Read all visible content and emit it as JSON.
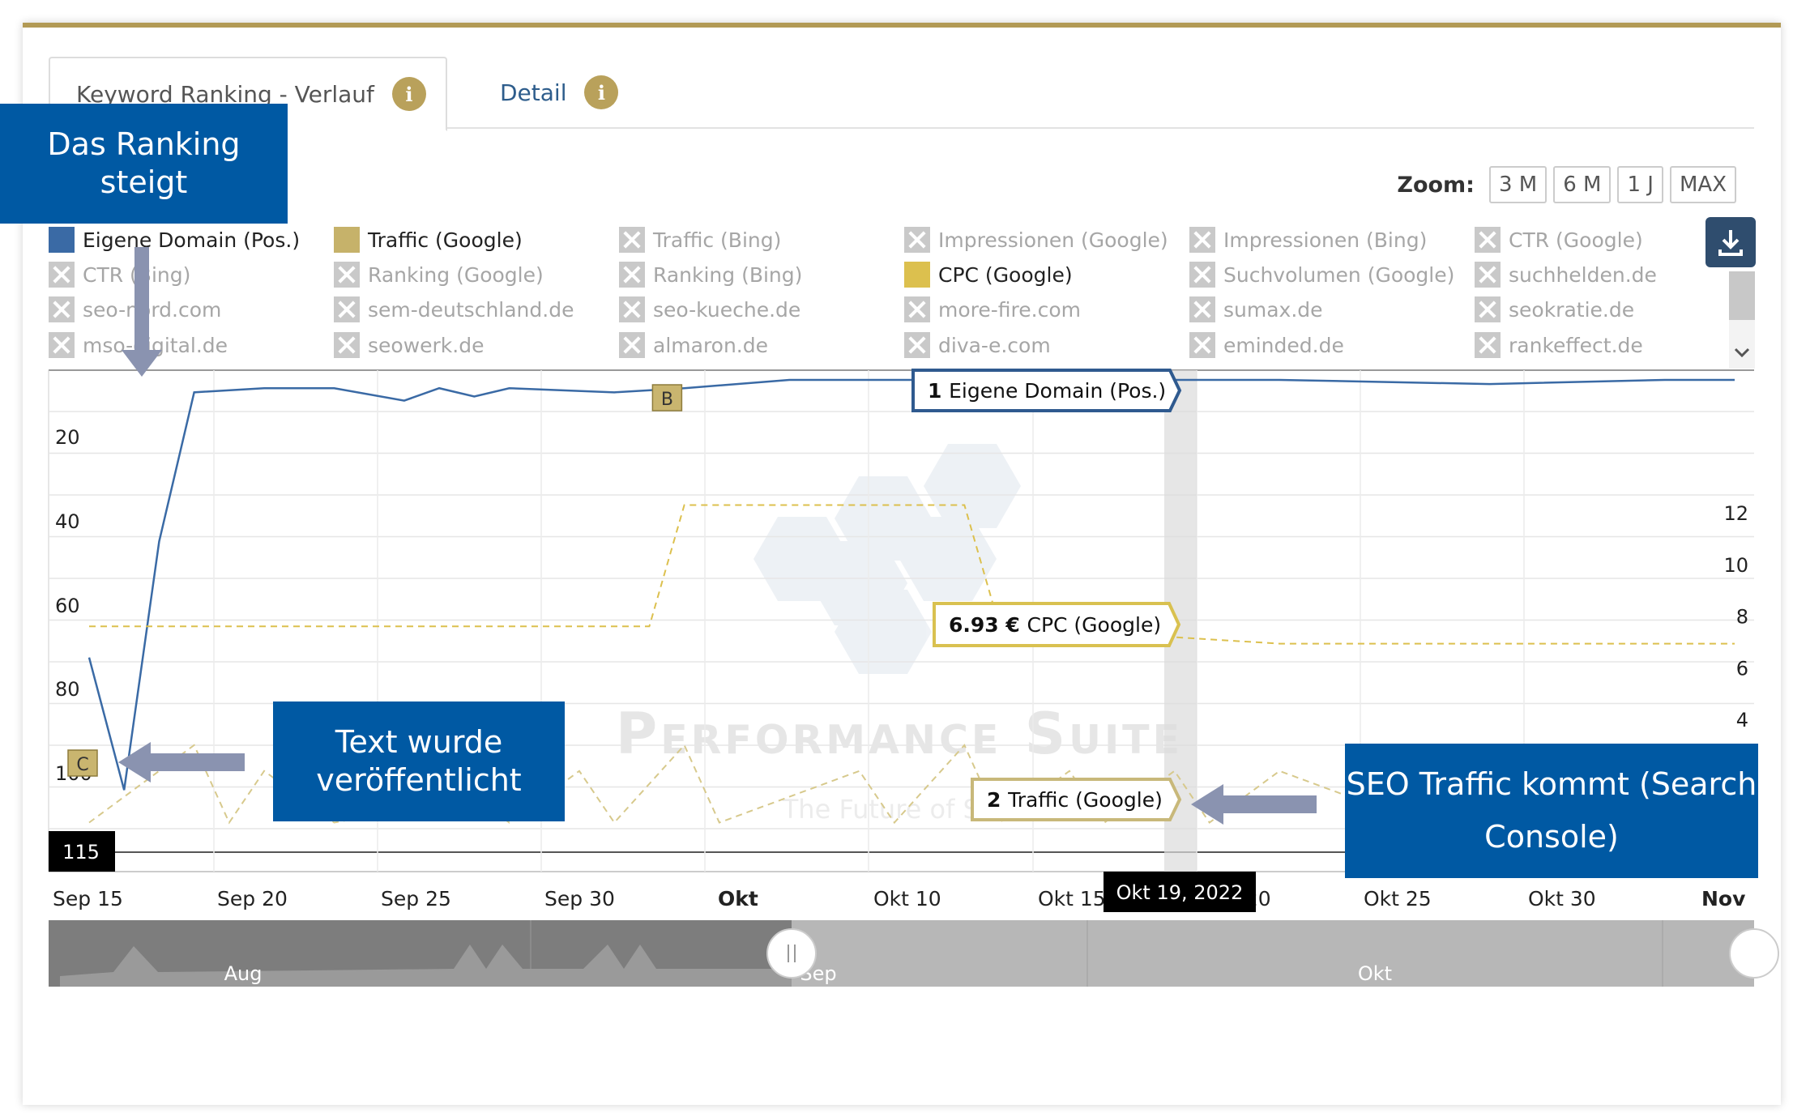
{
  "tabs": [
    {
      "label": "Keyword Ranking - Verlauf",
      "active": true
    },
    {
      "label": "Detail",
      "active": false
    }
  ],
  "zoom": {
    "label": "Zoom:",
    "options": [
      "3 M",
      "6 M",
      "1 J",
      "MAX"
    ]
  },
  "legend": [
    {
      "label": "Eigene Domain (Pos.)",
      "on": true,
      "color": "#3a6aa5"
    },
    {
      "label": "Traffic (Google)",
      "on": true,
      "color": "#c6b26a"
    },
    {
      "label": "Traffic (Bing)",
      "on": false
    },
    {
      "label": "Impressionen (Google)",
      "on": false
    },
    {
      "label": "Impressionen (Bing)",
      "on": false
    },
    {
      "label": "CTR (Google)",
      "on": false
    },
    {
      "label": "CTR (Bing)",
      "on": false
    },
    {
      "label": "Ranking (Google)",
      "on": false
    },
    {
      "label": "Ranking (Bing)",
      "on": false
    },
    {
      "label": "CPC (Google)",
      "on": true,
      "color": "#dcc04e"
    },
    {
      "label": "Suchvolumen (Google)",
      "on": false
    },
    {
      "label": "suchhelden.de",
      "on": false
    },
    {
      "label": "seo-nord.com",
      "on": false
    },
    {
      "label": "sem-deutschland.de",
      "on": false
    },
    {
      "label": "seo-kueche.de",
      "on": false
    },
    {
      "label": "more-fire.com",
      "on": false
    },
    {
      "label": "sumax.de",
      "on": false
    },
    {
      "label": "seokratie.de",
      "on": false
    },
    {
      "label": "mso-digital.de",
      "on": false
    },
    {
      "label": "seowerk.de",
      "on": false
    },
    {
      "label": "almaron.de",
      "on": false
    },
    {
      "label": "diva-e.com",
      "on": false
    },
    {
      "label": "eminded.de",
      "on": false
    },
    {
      "label": "rankeffect.de",
      "on": false
    }
  ],
  "callouts": {
    "ranking": "Das Ranking steigt",
    "text": "Text wurde veröffentlicht",
    "seo": "SEO Traffic kommt (Search Console)"
  },
  "watermark": {
    "title": "Performance Suite",
    "subtitle": "The Future of SEO"
  },
  "chart_data": {
    "type": "line",
    "x_labels": [
      "Sep 15",
      "Sep 20",
      "Sep 25",
      "Sep 30",
      "Okt",
      "Okt 10",
      "Okt 15",
      "Okt 20",
      "Okt 25",
      "Okt 30",
      "Nov"
    ],
    "left_axis": {
      "ticks": [
        20,
        40,
        60,
        80,
        100
      ],
      "min_label": "115",
      "reversed": true
    },
    "right_axis": {
      "ticks": [
        4,
        6,
        8,
        10,
        12
      ]
    },
    "series": [
      {
        "name": "Eigene Domain (Pos.)",
        "axis": "left",
        "color": "#3a6aa5",
        "points": [
          [
            "2022-09-15",
            68
          ],
          [
            "2022-09-16",
            100
          ],
          [
            "2022-09-17",
            40
          ],
          [
            "2022-09-18",
            4
          ],
          [
            "2022-09-20",
            3
          ],
          [
            "2022-09-22",
            3
          ],
          [
            "2022-09-24",
            6
          ],
          [
            "2022-09-25",
            3
          ],
          [
            "2022-09-26",
            5
          ],
          [
            "2022-09-27",
            3
          ],
          [
            "2022-09-30",
            4
          ],
          [
            "2022-10-02",
            3
          ],
          [
            "2022-10-05",
            1
          ],
          [
            "2022-10-10",
            1
          ],
          [
            "2022-10-15",
            1
          ],
          [
            "2022-10-19",
            1
          ],
          [
            "2022-10-25",
            2
          ],
          [
            "2022-10-30",
            1
          ],
          [
            "2022-11-01",
            1
          ]
        ]
      },
      {
        "name": "CPC (Google)",
        "axis": "right",
        "color": "#dcc04e",
        "dashed": true,
        "points": [
          [
            "2022-09-15",
            7.6
          ],
          [
            "2022-10-01",
            7.6
          ],
          [
            "2022-10-02",
            12.3
          ],
          [
            "2022-10-10",
            12.3
          ],
          [
            "2022-10-11",
            7.6
          ],
          [
            "2022-10-19",
            6.93
          ],
          [
            "2022-11-01",
            6.93
          ]
        ]
      },
      {
        "name": "Traffic (Google)",
        "axis": "right",
        "color": "#d7c98c",
        "dashed": true,
        "points": [
          [
            "2022-09-15",
            0
          ],
          [
            "2022-09-18",
            3
          ],
          [
            "2022-09-19",
            0
          ],
          [
            "2022-09-20",
            2
          ],
          [
            "2022-09-22",
            0
          ],
          [
            "2022-09-26",
            1
          ],
          [
            "2022-09-27",
            0
          ],
          [
            "2022-09-29",
            2
          ],
          [
            "2022-09-30",
            0
          ],
          [
            "2022-10-02",
            3
          ],
          [
            "2022-10-03",
            0
          ],
          [
            "2022-10-07",
            2
          ],
          [
            "2022-10-08",
            0
          ],
          [
            "2022-10-10",
            3
          ],
          [
            "2022-10-11",
            0
          ],
          [
            "2022-10-13",
            2
          ],
          [
            "2022-10-14",
            0
          ],
          [
            "2022-10-16",
            2
          ],
          [
            "2022-10-17",
            0
          ],
          [
            "2022-10-19",
            2
          ],
          [
            "2022-10-21",
            1
          ],
          [
            "2022-10-22",
            0
          ],
          [
            "2022-10-24",
            2
          ]
        ]
      }
    ],
    "flags": [
      {
        "label": "B",
        "date": "2022-10-01"
      },
      {
        "label": "C",
        "date": "2022-09-15"
      }
    ],
    "tooltips": {
      "date": "Okt 19, 2022",
      "rank_value": "1",
      "rank_name": "Eigene Domain (Pos.)",
      "cpc_value": "6.93 €",
      "cpc_name": "CPC (Google)",
      "traffic_value": "2",
      "traffic_name": "Traffic (Google)"
    },
    "navigator_labels": [
      "Aug",
      "Sep",
      "Okt"
    ]
  }
}
